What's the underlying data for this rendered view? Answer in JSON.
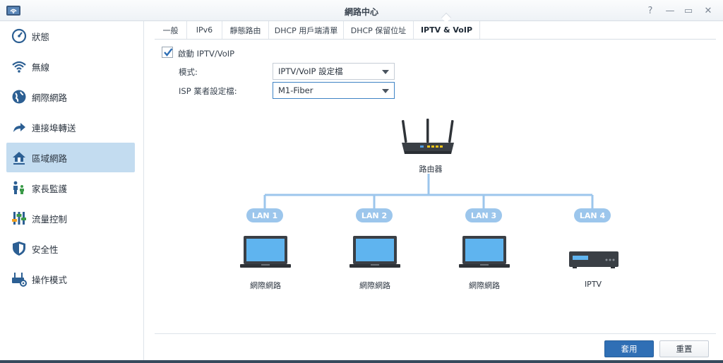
{
  "window": {
    "title": "網路中心",
    "controls": [
      "help-icon",
      "minimize-icon",
      "maximize-icon",
      "close-icon"
    ],
    "help_glyph": "?",
    "minimize_glyph": "—",
    "maximize_glyph": "▭",
    "close_glyph": "✕"
  },
  "sidebar": {
    "items": [
      {
        "label": "狀態",
        "icon": "gauge-icon"
      },
      {
        "label": "無線",
        "icon": "wifi-icon"
      },
      {
        "label": "網際網路",
        "icon": "globe-icon"
      },
      {
        "label": "連接埠轉送",
        "icon": "arrow-forward-icon"
      },
      {
        "label": "區域網路",
        "icon": "home-network-icon",
        "active": true
      },
      {
        "label": "家長監護",
        "icon": "family-icon"
      },
      {
        "label": "流量控制",
        "icon": "sliders-icon"
      },
      {
        "label": "安全性",
        "icon": "shield-icon"
      },
      {
        "label": "操作模式",
        "icon": "router-gear-icon"
      }
    ]
  },
  "tabs": [
    {
      "label": "一般"
    },
    {
      "label": "IPv6"
    },
    {
      "label": "靜態路由"
    },
    {
      "label": "DHCP 用戶端清單"
    },
    {
      "label": "DHCP 保留位址"
    },
    {
      "label": "IPTV & VoIP",
      "active": true
    }
  ],
  "form": {
    "enable_label": "啟動 IPTV/VoIP",
    "enable_checked": true,
    "mode_label": "模式:",
    "mode_value": "IPTV/VoIP 設定檔",
    "isp_label": "ISP 業者設定檔:",
    "isp_value": "M1-Fiber"
  },
  "diagram": {
    "router_label": "路由器",
    "ports": [
      "LAN 1",
      "LAN 2",
      "LAN 3",
      "LAN 4"
    ],
    "devices": [
      {
        "type": "laptop",
        "label": "網際網路"
      },
      {
        "type": "laptop",
        "label": "網際網路"
      },
      {
        "type": "laptop",
        "label": "網際網路"
      },
      {
        "type": "settop-box",
        "label": "IPTV"
      }
    ]
  },
  "footer": {
    "apply_label": "套用",
    "reset_label": "重置"
  },
  "colors": {
    "accent": "#2f6fb5",
    "sidebar_active": "#c3dcf0",
    "lan_pill": "#9cc6ec",
    "device_screen": "#5fb4ef"
  }
}
